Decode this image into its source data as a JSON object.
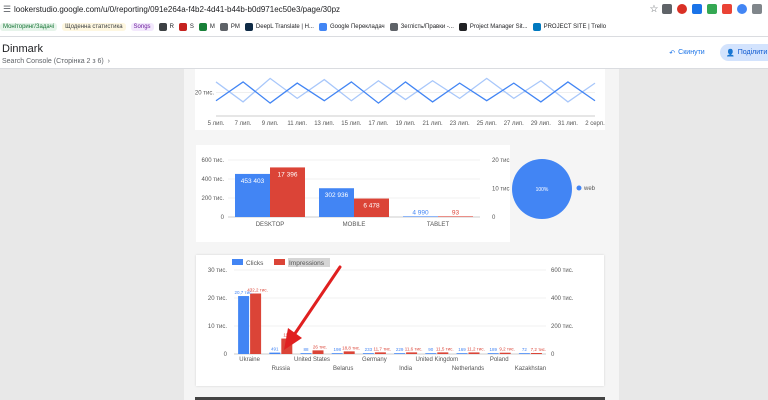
{
  "browser": {
    "url": "lookerstudio.google.com/u/0/reporting/091e264a-f4b2-4d41-b44b-b0d971ec50e3/page/30pz",
    "bookmarks": [
      {
        "label": "Моніторинг/Задачі",
        "type": "chip",
        "bg": "#e6f4ea",
        "fg": "#137333"
      },
      {
        "label": "Щоденна статистика",
        "type": "chip",
        "bg": "#fef7e0",
        "fg": "#3c4043"
      },
      {
        "label": "Songs",
        "type": "chip",
        "bg": "#f3e8fd",
        "fg": "#6a1b9a"
      },
      {
        "label": "R",
        "icon_color": "#3c4043"
      },
      {
        "label": "S",
        "icon_color": "#c5221f"
      },
      {
        "label": "M",
        "icon_color": "#188038"
      },
      {
        "label": "PM",
        "icon_color": "#5f6368"
      },
      {
        "label": "DeepL Translate | H...",
        "icon_color": "#0f2b46"
      },
      {
        "label": "Google Перекладач",
        "icon_color": "#4285f4"
      },
      {
        "label": "Зеглість/Правки -...",
        "icon_color": "#5f6368"
      },
      {
        "label": "Project Manager Sit...",
        "icon_color": "#202124"
      },
      {
        "label": "PROJECT SITE | Trello",
        "icon_color": "#0079bf"
      }
    ]
  },
  "report": {
    "title": "Dinmark",
    "subtitle": "Search Console (Сторінка 2 з 6)",
    "reset_label": "Скинути",
    "share_label": "Поділити"
  },
  "colors": {
    "blue": "#4285f4",
    "red": "#db4437",
    "light_blue": "#a8c7fa"
  },
  "chart_data": [
    {
      "type": "line",
      "y_tick_label": "20 тис.",
      "x": [
        "5 лип.",
        "7 лип.",
        "9 лип.",
        "11 лип.",
        "13 лип.",
        "15 лип.",
        "17 лип.",
        "19 лип.",
        "21 лип.",
        "23 лип.",
        "25 лип.",
        "27 лип.",
        "29 лип.",
        "31 лип.",
        "2 серп."
      ],
      "series": [
        {
          "values": [
            24500,
            16000,
            26000,
            17500,
            25500,
            16500,
            25000,
            17000,
            25000,
            17500,
            26000,
            17500,
            25000,
            16000,
            24000
          ]
        },
        {
          "values": [
            16500,
            24500,
            15500,
            24000,
            16500,
            24500,
            15500,
            24500,
            16000,
            24000,
            16500,
            24000,
            16000,
            24500,
            16500
          ]
        }
      ],
      "ylim": [
        10000,
        30000
      ]
    },
    {
      "type": "bar",
      "categories": [
        "DESKTOP",
        "MOBILE",
        "TABLET"
      ],
      "series": [
        {
          "values": [
            453403,
            302936,
            4990
          ],
          "labels": [
            "453 403",
            "302 936",
            "4 990"
          ]
        },
        {
          "values": [
            17396,
            6478,
            93
          ],
          "labels": [
            "17 396",
            "6 478",
            "93"
          ]
        }
      ],
      "left_ticks": [
        "600 тис.",
        "400 тис.",
        "200 тис.",
        "0"
      ],
      "right_ticks": [
        "20 тис.",
        "10 тис.",
        "0"
      ],
      "ylim": [
        0,
        600000
      ],
      "y2lim": [
        0,
        20000
      ]
    },
    {
      "type": "pie",
      "slices": [
        {
          "label": "web",
          "value": 100,
          "display": "100%"
        }
      ]
    },
    {
      "type": "bar",
      "legend": [
        "Clicks",
        "Impressions"
      ],
      "categories": [
        "Ukraine",
        "Russia",
        "United States",
        "Belarus",
        "Germany",
        "India",
        "United Kingdom",
        "Netherlands",
        "Poland",
        "Kazakhstan"
      ],
      "series": [
        {
          "name": "Clicks",
          "values": [
            20700,
            491,
            88,
            198,
            233,
            229,
            90,
            169,
            189,
            72
          ],
          "labels": [
            "20,7 тис.",
            "491",
            "88",
            "198",
            "233",
            "229",
            "90",
            "169",
            "189",
            "72"
          ]
        },
        {
          "name": "Impressions",
          "values": [
            432200,
            110300,
            26000,
            18800,
            11700,
            11600,
            11500,
            11200,
            9200,
            7200
          ],
          "labels": [
            "432,2 тис.",
            "110,3",
            "26 тис.",
            "18,8 тис.",
            "11,7 тис.",
            "11,6 тис.",
            "11,5 тис.",
            "11,2 тис.",
            "9,2 тис.",
            "7,2 тис."
          ]
        }
      ],
      "left_ticks": [
        "30 тис.",
        "20 тис.",
        "10 тис.",
        "0"
      ],
      "right_ticks": [
        "600 тис.",
        "400 тис.",
        "200 тис.",
        "0"
      ],
      "ylim": [
        0,
        30000
      ],
      "y2lim": [
        0,
        600000
      ]
    }
  ]
}
